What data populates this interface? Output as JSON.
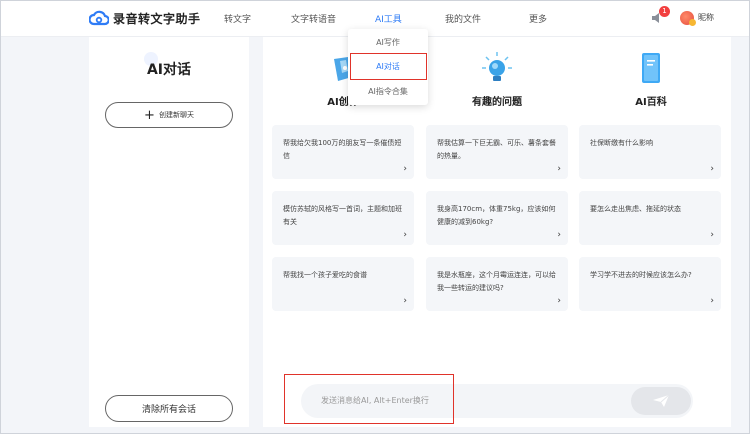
{
  "app": {
    "name": "录音转文字助手"
  },
  "nav": {
    "items": [
      "转文字",
      "文字转语音",
      "AI工具",
      "我的文件",
      "更多"
    ],
    "notification_count": "1",
    "username": "昵称"
  },
  "dropdown": {
    "items": [
      "AI写作",
      "AI对话",
      "AI指令合集"
    ],
    "selected": "AI对话"
  },
  "sidebar": {
    "title": "AI对话",
    "new_chat": "创建新聊天",
    "clear_all": "清除所有会话"
  },
  "categories": [
    {
      "title": "AI创作",
      "icon": "pen-icon"
    },
    {
      "title": "有趣的问题",
      "icon": "lightbulb-icon"
    },
    {
      "title": "AI百科",
      "icon": "book-icon"
    }
  ],
  "cards": [
    [
      "帮我给欠我100万的朋友写一条催债短信",
      "帮我估算一下巨无霸、可乐、薯条套餐的热量。",
      "社保断缴有什么影响"
    ],
    [
      "模仿苏轼的风格写一首词，主题和加班有关",
      "我身高170cm，体重75kg，应该如何健康的减到60kg?",
      "要怎么走出焦虑、拖延的状态"
    ],
    [
      "帮我找一个孩子爱吃的食谱",
      "我是水瓶座，这个月霉运连连，可以给我一些转运的建议吗?",
      "学习学不进去的时候应该怎么办?"
    ]
  ],
  "chat_input": {
    "placeholder": "发送消息给AI, Alt+Enter换行"
  },
  "colors": {
    "accent": "#2f7cf6",
    "highlight": "#e0332a"
  }
}
